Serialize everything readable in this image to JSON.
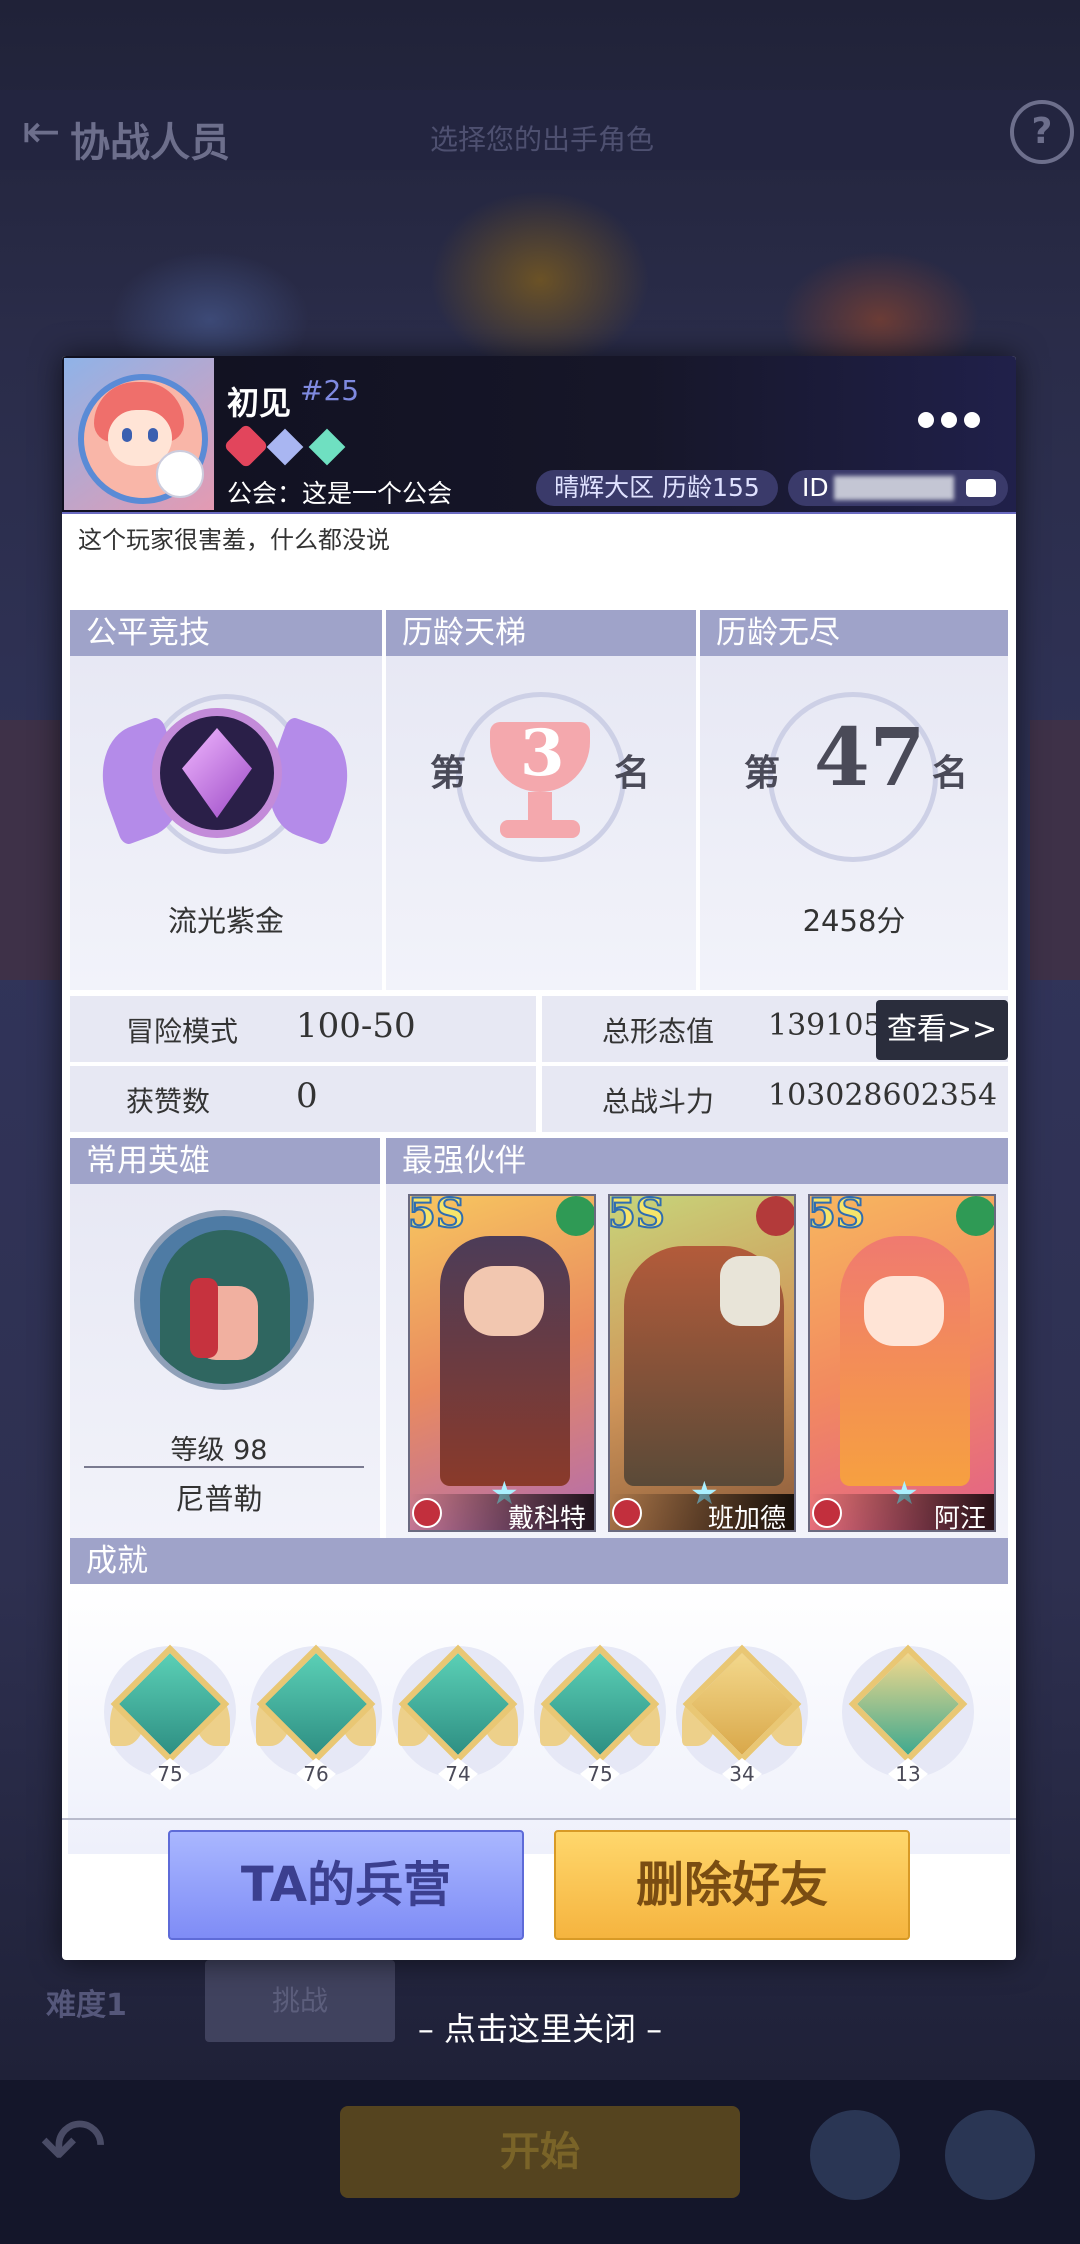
{
  "background": {
    "title": "协战人员",
    "subtitle": "选择您的出手角色",
    "level_label": "难度1",
    "level_button": "挑战",
    "start_button": "开始"
  },
  "profile": {
    "name": "初见",
    "tag": "#25",
    "guild": "公会：这是一个公会",
    "region": "晴辉大区  历龄155",
    "id_label": "ID",
    "signature": "这个玩家很害羞，什么都没说"
  },
  "ranks": {
    "fair": {
      "header": "公平竞技",
      "caption": "流光紫金"
    },
    "ladder": {
      "header": "历龄天梯",
      "prefix": "第",
      "rank": "3",
      "suffix": "名"
    },
    "endless": {
      "header": "历龄无尽",
      "prefix": "第",
      "rank": "47",
      "suffix": "名",
      "caption": "2458分"
    }
  },
  "stats": {
    "adventure_label": "冒险模式",
    "adventure_value": "100-50",
    "likes_label": "获赞数",
    "likes_value": "0",
    "forms_label": "总形态值",
    "forms_value": "139105",
    "power_label": "总战斗力",
    "power_value": "103028602354",
    "view_button": "查看>>"
  },
  "hero": {
    "header": "常用英雄",
    "level": "等级 98",
    "name": "尼普勒"
  },
  "partners": {
    "header": "最强伙伴",
    "list": [
      {
        "grade": "5S",
        "name": "戴科特",
        "element_color": "#2f9a55"
      },
      {
        "grade": "5S",
        "name": "班加德",
        "element_color": "#b33a3a"
      },
      {
        "grade": "5S",
        "name": "阿汪",
        "element_color": "#2f9a55"
      }
    ]
  },
  "achievements": {
    "header": "成就",
    "list": [
      {
        "count": "75"
      },
      {
        "count": "76"
      },
      {
        "count": "74"
      },
      {
        "count": "75"
      },
      {
        "count": "34"
      },
      {
        "count": "13"
      }
    ]
  },
  "actions": {
    "barracks": "TA的兵营",
    "delete": "删除好友"
  },
  "close_hint": "– 点击这里关闭 –",
  "colors": {
    "section_header": "#9fa3c9",
    "barracks_button": "#8f9cfa",
    "delete_button": "#f8c24f",
    "header_bg": "#101020"
  }
}
